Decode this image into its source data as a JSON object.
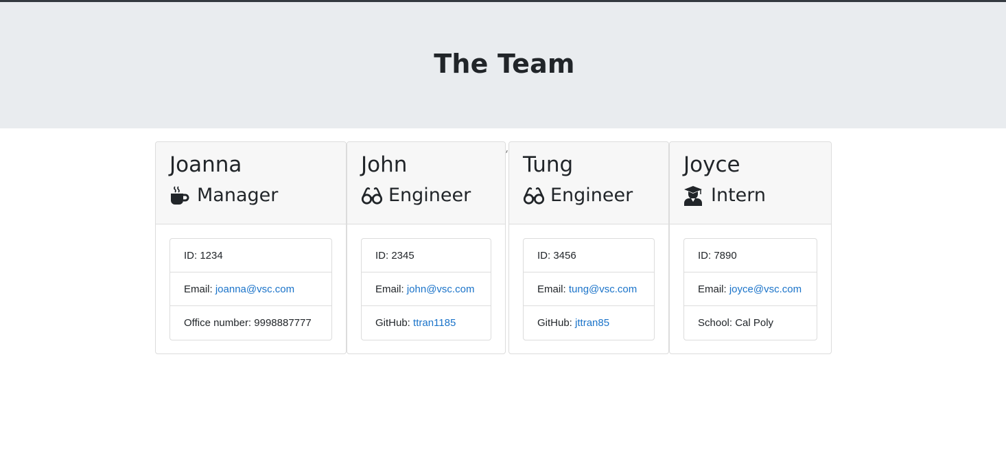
{
  "header": {
    "title": "The Team"
  },
  "members": [
    {
      "name": "Joanna",
      "role": "Manager",
      "icon": "coffee-mug-icon",
      "id_text": "ID: 1234",
      "email_prefix": "Email: ",
      "email": "joanna@vsc.com",
      "extra_prefix": "Office number: 9998887777",
      "extra_link": ""
    },
    {
      "name": "John",
      "role": "Engineer",
      "icon": "glasses-icon",
      "id_text": "ID: 2345",
      "email_prefix": "Email: ",
      "email": "john@vsc.com",
      "extra_prefix": "GitHub: ",
      "extra_link": "ttran1185"
    },
    {
      "name": "Tung",
      "role": "Engineer",
      "icon": "glasses-icon",
      "id_text": "ID: 3456",
      "email_prefix": "Email: ",
      "email": "tung@vsc.com",
      "extra_prefix": "GitHub: ",
      "extra_link": "jttran85"
    },
    {
      "name": "Joyce",
      "role": "Intern",
      "icon": "graduate-icon",
      "id_text": "ID: 7890",
      "email_prefix": "Email: ",
      "email": "joyce@vsc.com",
      "extra_prefix": "School: Cal Poly",
      "extra_link": ""
    }
  ],
  "colors": {
    "jumbotron": "#e9ecef",
    "header": "#f7f7f7",
    "link": "#1a73c9",
    "top_bar": "#343a40"
  }
}
